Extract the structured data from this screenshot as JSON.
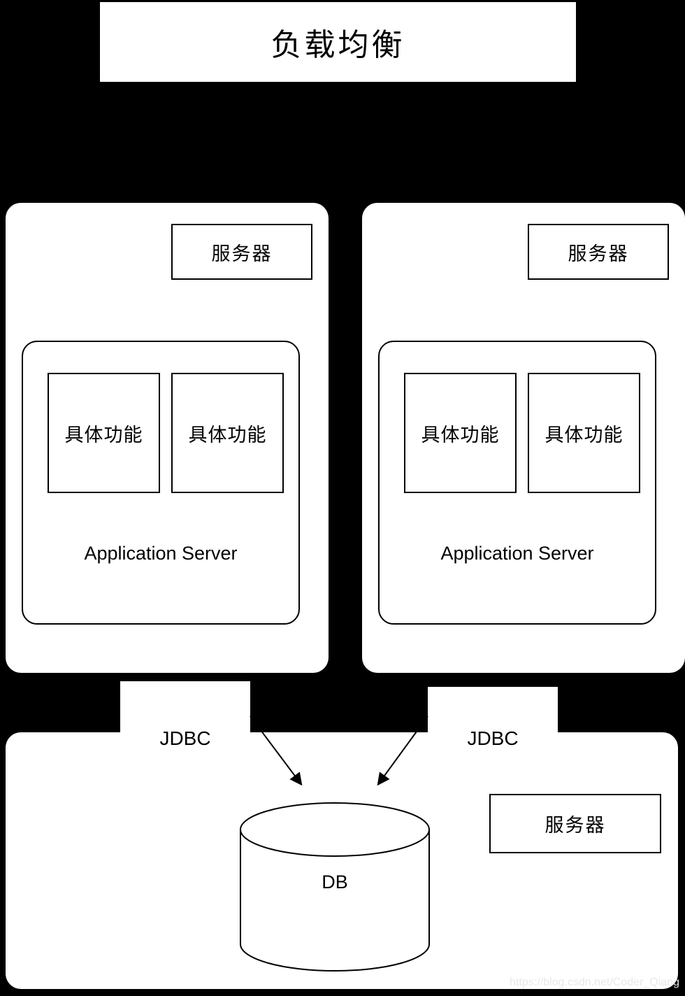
{
  "diagram": {
    "title": "负载均衡",
    "watermark": "https://blog.csdn.net/Coder_Qiang",
    "colors": {
      "background": "#000000",
      "panel": "#ffffff",
      "stroke": "#000000",
      "watermark": "#e8e8e8"
    }
  },
  "server_nodes": [
    {
      "id": "server-left",
      "tag_label": "服务器",
      "app_server_label": "Application Server",
      "functions": [
        {
          "label": "具体功能"
        },
        {
          "label": "具体功能"
        }
      ]
    },
    {
      "id": "server-right",
      "tag_label": "服务器",
      "app_server_label": "Application Server",
      "functions": [
        {
          "label": "具体功能"
        },
        {
          "label": "具体功能"
        }
      ]
    }
  ],
  "connectors": [
    {
      "id": "jdbc-left",
      "label": "JDBC"
    },
    {
      "id": "jdbc-right",
      "label": "JDBC"
    }
  ],
  "database_node": {
    "db_label": "DB",
    "tag_label": "服务器"
  }
}
